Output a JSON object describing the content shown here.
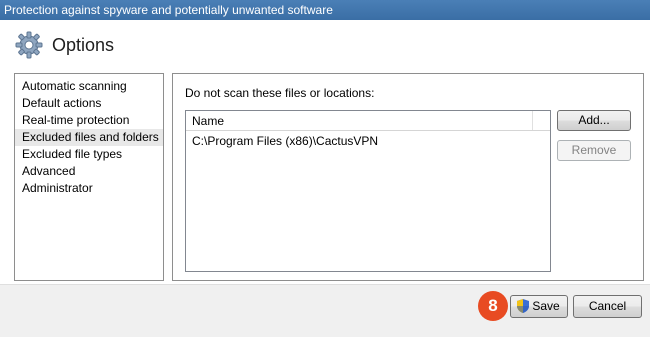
{
  "window": {
    "title": "Protection against spyware and potentially unwanted software"
  },
  "header": {
    "title": "Options",
    "icon": "gear-icon"
  },
  "sidebar": {
    "items": [
      {
        "label": "Automatic scanning",
        "selected": false
      },
      {
        "label": "Default actions",
        "selected": false
      },
      {
        "label": "Real-time protection",
        "selected": false
      },
      {
        "label": "Excluded files and folders",
        "selected": true
      },
      {
        "label": "Excluded file types",
        "selected": false
      },
      {
        "label": "Advanced",
        "selected": false
      },
      {
        "label": "Administrator",
        "selected": false
      }
    ]
  },
  "panel": {
    "heading": "Do not scan these files or locations:",
    "list": {
      "columns": [
        "Name"
      ],
      "rows": [
        "C:\\Program Files (x86)\\CactusVPN"
      ]
    },
    "add_label": "Add...",
    "remove_label": "Remove"
  },
  "footer": {
    "step_badge": "8",
    "save_label": "Save",
    "save_icon": "uac-shield-icon",
    "cancel_label": "Cancel"
  },
  "colors": {
    "titlebar": "#3a6ea5",
    "badge": "#e84b22",
    "footer_bg": "#f0f0f0"
  }
}
